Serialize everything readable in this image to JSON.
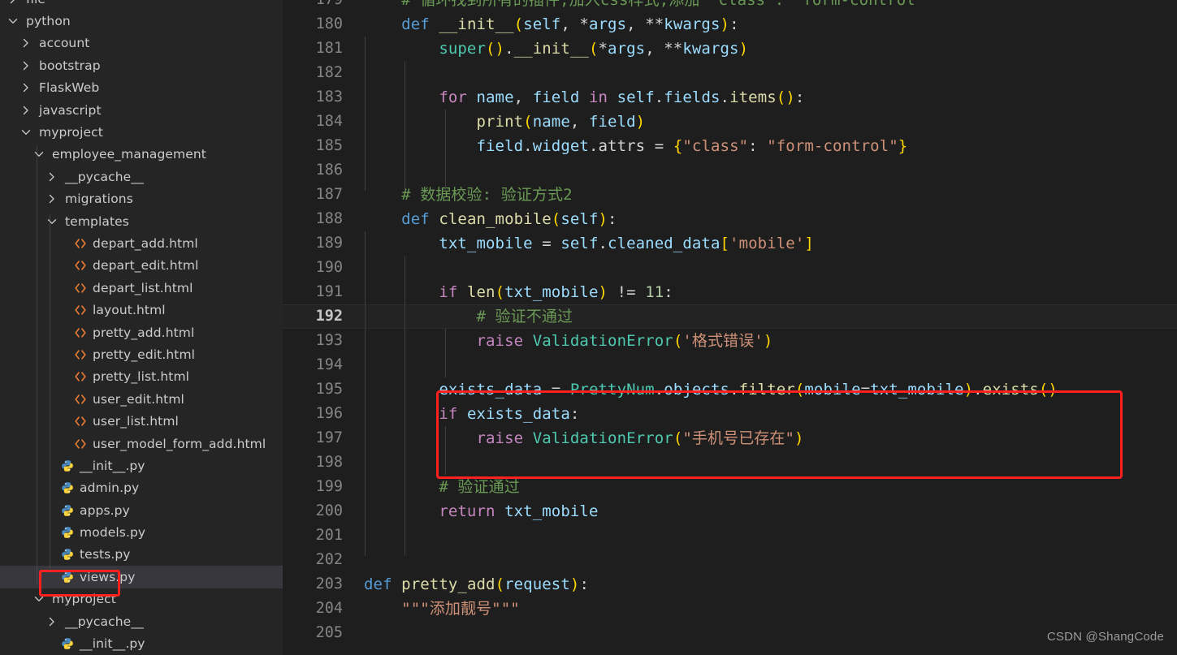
{
  "sidebar": {
    "background_color": "#252526",
    "selected_row_color": "#37373d",
    "annotation_color": "#ff2020",
    "items": [
      {
        "label": "file",
        "type": "folder",
        "expanded": false,
        "depth": 0,
        "partial": true
      },
      {
        "label": "python",
        "type": "folder",
        "expanded": true,
        "depth": 0
      },
      {
        "label": "account",
        "type": "folder",
        "expanded": false,
        "depth": 1
      },
      {
        "label": "bootstrap",
        "type": "folder",
        "expanded": false,
        "depth": 1
      },
      {
        "label": "FlaskWeb",
        "type": "folder",
        "expanded": false,
        "depth": 1
      },
      {
        "label": "javascript",
        "type": "folder",
        "expanded": false,
        "depth": 1
      },
      {
        "label": "myproject",
        "type": "folder",
        "expanded": true,
        "depth": 1
      },
      {
        "label": "employee_management",
        "type": "folder",
        "expanded": true,
        "depth": 2
      },
      {
        "label": "__pycache__",
        "type": "folder",
        "expanded": false,
        "depth": 3
      },
      {
        "label": "migrations",
        "type": "folder",
        "expanded": false,
        "depth": 3
      },
      {
        "label": "templates",
        "type": "folder",
        "expanded": true,
        "depth": 3
      },
      {
        "label": "depart_add.html",
        "type": "html",
        "depth": 4
      },
      {
        "label": "depart_edit.html",
        "type": "html",
        "depth": 4
      },
      {
        "label": "depart_list.html",
        "type": "html",
        "depth": 4
      },
      {
        "label": "layout.html",
        "type": "html",
        "depth": 4
      },
      {
        "label": "pretty_add.html",
        "type": "html",
        "depth": 4
      },
      {
        "label": "pretty_edit.html",
        "type": "html",
        "depth": 4
      },
      {
        "label": "pretty_list.html",
        "type": "html",
        "depth": 4
      },
      {
        "label": "user_edit.html",
        "type": "html",
        "depth": 4
      },
      {
        "label": "user_list.html",
        "type": "html",
        "depth": 4
      },
      {
        "label": "user_model_form_add.html",
        "type": "html",
        "depth": 4
      },
      {
        "label": "__init__.py",
        "type": "python",
        "depth": 3
      },
      {
        "label": "admin.py",
        "type": "python",
        "depth": 3
      },
      {
        "label": "apps.py",
        "type": "python",
        "depth": 3
      },
      {
        "label": "models.py",
        "type": "python",
        "depth": 3
      },
      {
        "label": "tests.py",
        "type": "python",
        "depth": 3
      },
      {
        "label": "views.py",
        "type": "python",
        "depth": 3,
        "selected": true,
        "annotated": true
      },
      {
        "label": "myproject",
        "type": "folder",
        "expanded": true,
        "depth": 2
      },
      {
        "label": "__pycache__",
        "type": "folder",
        "expanded": false,
        "depth": 3
      },
      {
        "label": "__init__.py",
        "type": "python",
        "depth": 3,
        "partial": true
      }
    ]
  },
  "editor": {
    "background_color": "#1e1e1e",
    "gutter_color": "#858585",
    "current_line": 192,
    "annotation_color": "#ff2020",
    "annotated_lines": [
      195,
      196,
      197
    ],
    "lines": [
      {
        "n": 179,
        "tokens": [
          {
            "t": "    ",
            "c": "c-plain"
          },
          {
            "t": "# 循环找到所有的插件,加入css样式,添加 \"class\": \"form-control\"",
            "c": "c-com"
          }
        ]
      },
      {
        "n": 180,
        "tokens": [
          {
            "t": "    ",
            "c": "c-plain"
          },
          {
            "t": "def",
            "c": "c-kw"
          },
          {
            "t": " ",
            "c": "c-plain"
          },
          {
            "t": "__init__",
            "c": "c-fn"
          },
          {
            "t": "(",
            "c": "c-p1"
          },
          {
            "t": "self",
            "c": "c-var"
          },
          {
            "t": ", ",
            "c": "c-plain"
          },
          {
            "t": "*",
            "c": "c-plain"
          },
          {
            "t": "args",
            "c": "c-var"
          },
          {
            "t": ", ",
            "c": "c-plain"
          },
          {
            "t": "**",
            "c": "c-plain"
          },
          {
            "t": "kwargs",
            "c": "c-var"
          },
          {
            "t": ")",
            "c": "c-p1"
          },
          {
            "t": ":",
            "c": "c-plain"
          }
        ]
      },
      {
        "n": 181,
        "tokens": [
          {
            "t": "        ",
            "c": "c-plain"
          },
          {
            "t": "super",
            "c": "c-cls"
          },
          {
            "t": "()",
            "c": "c-p1"
          },
          {
            "t": ".",
            "c": "c-plain"
          },
          {
            "t": "__init__",
            "c": "c-fn"
          },
          {
            "t": "(",
            "c": "c-p1"
          },
          {
            "t": "*",
            "c": "c-plain"
          },
          {
            "t": "args",
            "c": "c-var"
          },
          {
            "t": ", ",
            "c": "c-plain"
          },
          {
            "t": "**",
            "c": "c-plain"
          },
          {
            "t": "kwargs",
            "c": "c-var"
          },
          {
            "t": ")",
            "c": "c-p1"
          }
        ]
      },
      {
        "n": 182,
        "tokens": []
      },
      {
        "n": 183,
        "tokens": [
          {
            "t": "        ",
            "c": "c-plain"
          },
          {
            "t": "for",
            "c": "c-ctl"
          },
          {
            "t": " ",
            "c": "c-plain"
          },
          {
            "t": "name",
            "c": "c-var"
          },
          {
            "t": ", ",
            "c": "c-plain"
          },
          {
            "t": "field",
            "c": "c-var"
          },
          {
            "t": " ",
            "c": "c-plain"
          },
          {
            "t": "in",
            "c": "c-ctl"
          },
          {
            "t": " ",
            "c": "c-plain"
          },
          {
            "t": "self",
            "c": "c-var"
          },
          {
            "t": ".",
            "c": "c-plain"
          },
          {
            "t": "fields",
            "c": "c-var"
          },
          {
            "t": ".",
            "c": "c-plain"
          },
          {
            "t": "items",
            "c": "c-fn"
          },
          {
            "t": "()",
            "c": "c-p1"
          },
          {
            "t": ":",
            "c": "c-plain"
          }
        ]
      },
      {
        "n": 184,
        "tokens": [
          {
            "t": "            ",
            "c": "c-plain"
          },
          {
            "t": "print",
            "c": "c-fn"
          },
          {
            "t": "(",
            "c": "c-p1"
          },
          {
            "t": "name",
            "c": "c-var"
          },
          {
            "t": ", ",
            "c": "c-plain"
          },
          {
            "t": "field",
            "c": "c-var"
          },
          {
            "t": ")",
            "c": "c-p1"
          }
        ]
      },
      {
        "n": 185,
        "tokens": [
          {
            "t": "            ",
            "c": "c-plain"
          },
          {
            "t": "field",
            "c": "c-var"
          },
          {
            "t": ".",
            "c": "c-plain"
          },
          {
            "t": "widget",
            "c": "c-var"
          },
          {
            "t": ".",
            "c": "c-plain"
          },
          {
            "t": "attrs",
            "c": "c-plain"
          },
          {
            "t": " = ",
            "c": "c-plain"
          },
          {
            "t": "{",
            "c": "c-p1"
          },
          {
            "t": "\"class\"",
            "c": "c-str"
          },
          {
            "t": ": ",
            "c": "c-plain"
          },
          {
            "t": "\"form-control\"",
            "c": "c-str"
          },
          {
            "t": "}",
            "c": "c-p1"
          }
        ]
      },
      {
        "n": 186,
        "tokens": []
      },
      {
        "n": 187,
        "tokens": [
          {
            "t": "    ",
            "c": "c-plain"
          },
          {
            "t": "# 数据校验: 验证方式2",
            "c": "c-com"
          }
        ]
      },
      {
        "n": 188,
        "tokens": [
          {
            "t": "    ",
            "c": "c-plain"
          },
          {
            "t": "def",
            "c": "c-kw"
          },
          {
            "t": " ",
            "c": "c-plain"
          },
          {
            "t": "clean_mobile",
            "c": "c-fn"
          },
          {
            "t": "(",
            "c": "c-p1"
          },
          {
            "t": "self",
            "c": "c-var"
          },
          {
            "t": ")",
            "c": "c-p1"
          },
          {
            "t": ":",
            "c": "c-plain"
          }
        ]
      },
      {
        "n": 189,
        "tokens": [
          {
            "t": "        ",
            "c": "c-plain"
          },
          {
            "t": "txt_mobile",
            "c": "c-var"
          },
          {
            "t": " = ",
            "c": "c-plain"
          },
          {
            "t": "self",
            "c": "c-var"
          },
          {
            "t": ".",
            "c": "c-plain"
          },
          {
            "t": "cleaned_data",
            "c": "c-var"
          },
          {
            "t": "[",
            "c": "c-p1"
          },
          {
            "t": "'mobile'",
            "c": "c-str"
          },
          {
            "t": "]",
            "c": "c-p1"
          }
        ]
      },
      {
        "n": 190,
        "tokens": []
      },
      {
        "n": 191,
        "tokens": [
          {
            "t": "        ",
            "c": "c-plain"
          },
          {
            "t": "if",
            "c": "c-ctl"
          },
          {
            "t": " ",
            "c": "c-plain"
          },
          {
            "t": "len",
            "c": "c-fn"
          },
          {
            "t": "(",
            "c": "c-p1"
          },
          {
            "t": "txt_mobile",
            "c": "c-var"
          },
          {
            "t": ")",
            "c": "c-p1"
          },
          {
            "t": " != ",
            "c": "c-plain"
          },
          {
            "t": "11",
            "c": "c-num"
          },
          {
            "t": ":",
            "c": "c-plain"
          }
        ]
      },
      {
        "n": 192,
        "tokens": [
          {
            "t": "            ",
            "c": "c-plain"
          },
          {
            "t": "# 验证不通过",
            "c": "c-com"
          }
        ]
      },
      {
        "n": 193,
        "tokens": [
          {
            "t": "            ",
            "c": "c-plain"
          },
          {
            "t": "raise",
            "c": "c-ctl"
          },
          {
            "t": " ",
            "c": "c-plain"
          },
          {
            "t": "ValidationError",
            "c": "c-cls"
          },
          {
            "t": "(",
            "c": "c-p1"
          },
          {
            "t": "'格式错误'",
            "c": "c-str"
          },
          {
            "t": ")",
            "c": "c-p1"
          }
        ]
      },
      {
        "n": 194,
        "tokens": []
      },
      {
        "n": 195,
        "tokens": [
          {
            "t": "        ",
            "c": "c-plain"
          },
          {
            "t": "exists_data",
            "c": "c-var"
          },
          {
            "t": " = ",
            "c": "c-plain"
          },
          {
            "t": "PrettyNum",
            "c": "c-cls"
          },
          {
            "t": ".",
            "c": "c-plain"
          },
          {
            "t": "objects",
            "c": "c-var"
          },
          {
            "t": ".",
            "c": "c-plain"
          },
          {
            "t": "filter",
            "c": "c-fn"
          },
          {
            "t": "(",
            "c": "c-p1"
          },
          {
            "t": "mobile",
            "c": "c-var"
          },
          {
            "t": "=",
            "c": "c-plain"
          },
          {
            "t": "txt_mobile",
            "c": "c-var"
          },
          {
            "t": ")",
            "c": "c-p1"
          },
          {
            "t": ".",
            "c": "c-plain"
          },
          {
            "t": "exists",
            "c": "c-fn"
          },
          {
            "t": "()",
            "c": "c-p1"
          }
        ]
      },
      {
        "n": 196,
        "tokens": [
          {
            "t": "        ",
            "c": "c-plain"
          },
          {
            "t": "if",
            "c": "c-ctl"
          },
          {
            "t": " ",
            "c": "c-plain"
          },
          {
            "t": "exists_data",
            "c": "c-var"
          },
          {
            "t": ":",
            "c": "c-plain"
          }
        ]
      },
      {
        "n": 197,
        "tokens": [
          {
            "t": "            ",
            "c": "c-plain"
          },
          {
            "t": "raise",
            "c": "c-ctl"
          },
          {
            "t": " ",
            "c": "c-plain"
          },
          {
            "t": "ValidationError",
            "c": "c-cls"
          },
          {
            "t": "(",
            "c": "c-p1"
          },
          {
            "t": "\"手机号已存在\"",
            "c": "c-str"
          },
          {
            "t": ")",
            "c": "c-p1"
          }
        ]
      },
      {
        "n": 198,
        "tokens": []
      },
      {
        "n": 199,
        "tokens": [
          {
            "t": "        ",
            "c": "c-plain"
          },
          {
            "t": "# 验证通过",
            "c": "c-com"
          }
        ]
      },
      {
        "n": 200,
        "tokens": [
          {
            "t": "        ",
            "c": "c-plain"
          },
          {
            "t": "return",
            "c": "c-ctl"
          },
          {
            "t": " ",
            "c": "c-plain"
          },
          {
            "t": "txt_mobile",
            "c": "c-var"
          }
        ]
      },
      {
        "n": 201,
        "tokens": []
      },
      {
        "n": 202,
        "tokens": []
      },
      {
        "n": 203,
        "tokens": [
          {
            "t": "def",
            "c": "c-kw"
          },
          {
            "t": " ",
            "c": "c-plain"
          },
          {
            "t": "pretty_add",
            "c": "c-fn"
          },
          {
            "t": "(",
            "c": "c-p1"
          },
          {
            "t": "request",
            "c": "c-var"
          },
          {
            "t": ")",
            "c": "c-p1"
          },
          {
            "t": ":",
            "c": "c-plain"
          }
        ]
      },
      {
        "n": 204,
        "tokens": [
          {
            "t": "    ",
            "c": "c-plain"
          },
          {
            "t": "\"\"\"添加靓号\"\"\"",
            "c": "c-str"
          }
        ]
      },
      {
        "n": 205,
        "tokens": []
      }
    ]
  },
  "watermark": {
    "text": "CSDN @ShangCode"
  }
}
